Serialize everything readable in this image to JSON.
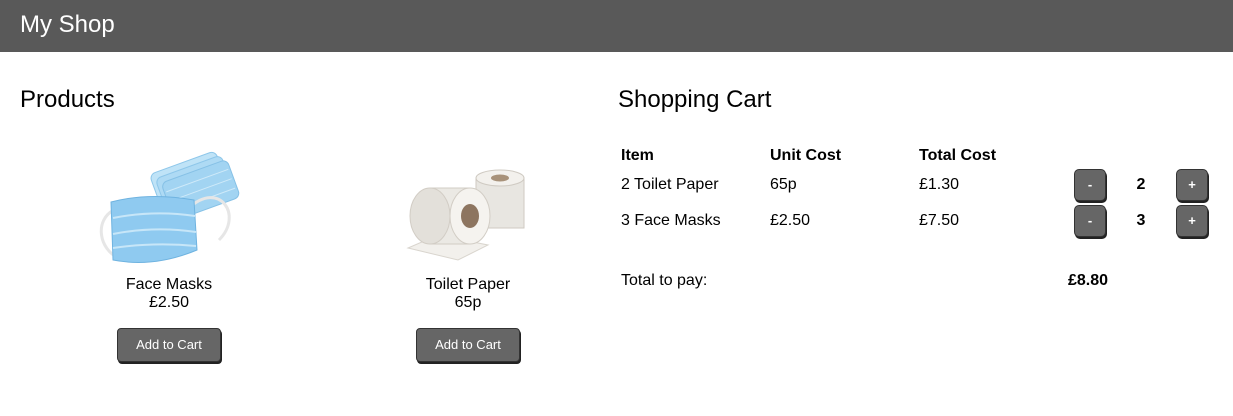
{
  "header": {
    "title": "My Shop"
  },
  "products": {
    "title": "Products",
    "items": [
      {
        "name": "Face Masks",
        "price": "£2.50",
        "button": "Add to Cart",
        "image": "face-masks"
      },
      {
        "name": "Toilet Paper",
        "price": "65p",
        "button": "Add to Cart",
        "image": "toilet-paper"
      }
    ]
  },
  "cart": {
    "title": "Shopping Cart",
    "columns": [
      "Item",
      "Unit Cost",
      "Total Cost"
    ],
    "rows": [
      {
        "item": "2 Toilet Paper",
        "unit": "65p",
        "total": "£1.30",
        "qty": "2",
        "minus": "-",
        "plus": "+"
      },
      {
        "item": "3 Face Masks",
        "unit": "£2.50",
        "total": "£7.50",
        "qty": "3",
        "minus": "-",
        "plus": "+"
      }
    ],
    "total_label": "Total to pay:",
    "total_amount": "£8.80"
  },
  "colors": {
    "header_bg": "#595959",
    "button_bg": "#666666",
    "mask_blue": "#9fd3f2"
  }
}
